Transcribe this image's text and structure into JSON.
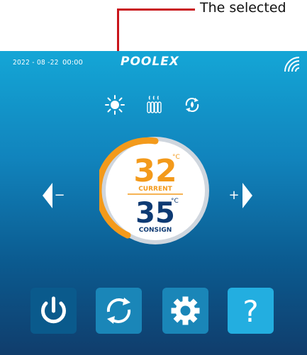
{
  "annotation": {
    "label": "The selected"
  },
  "status_bar": {
    "date": "2022 - 08 -22",
    "time": "00:00",
    "brand": "POOLEX",
    "wifi_icon": "wifi-icon"
  },
  "modes": [
    {
      "name": "heat-mode",
      "icon": "sun-icon",
      "selected": true
    },
    {
      "name": "heater-mode",
      "icon": "heater-icon",
      "selected": false
    },
    {
      "name": "auto-mode",
      "icon": "cycle-icon",
      "selected": false
    }
  ],
  "dial": {
    "current_value": "32",
    "current_unit": "°C",
    "current_label": "CURRENT",
    "consign_value": "35",
    "consign_unit": "°C",
    "consign_label": "CONSIGN"
  },
  "controls": {
    "minus": "−",
    "plus": "+"
  },
  "colors": {
    "accent_orange": "#f39a1b",
    "deep_blue": "#0d3a73",
    "button_dark": "#0a5a8c",
    "button_mid": "#1a86b8",
    "button_light": "#23aee0"
  },
  "buttons": [
    {
      "name": "power",
      "icon": "power-icon"
    },
    {
      "name": "refresh",
      "icon": "refresh-icon"
    },
    {
      "name": "settings",
      "icon": "gear-icon"
    },
    {
      "name": "help",
      "label": "?"
    }
  ]
}
